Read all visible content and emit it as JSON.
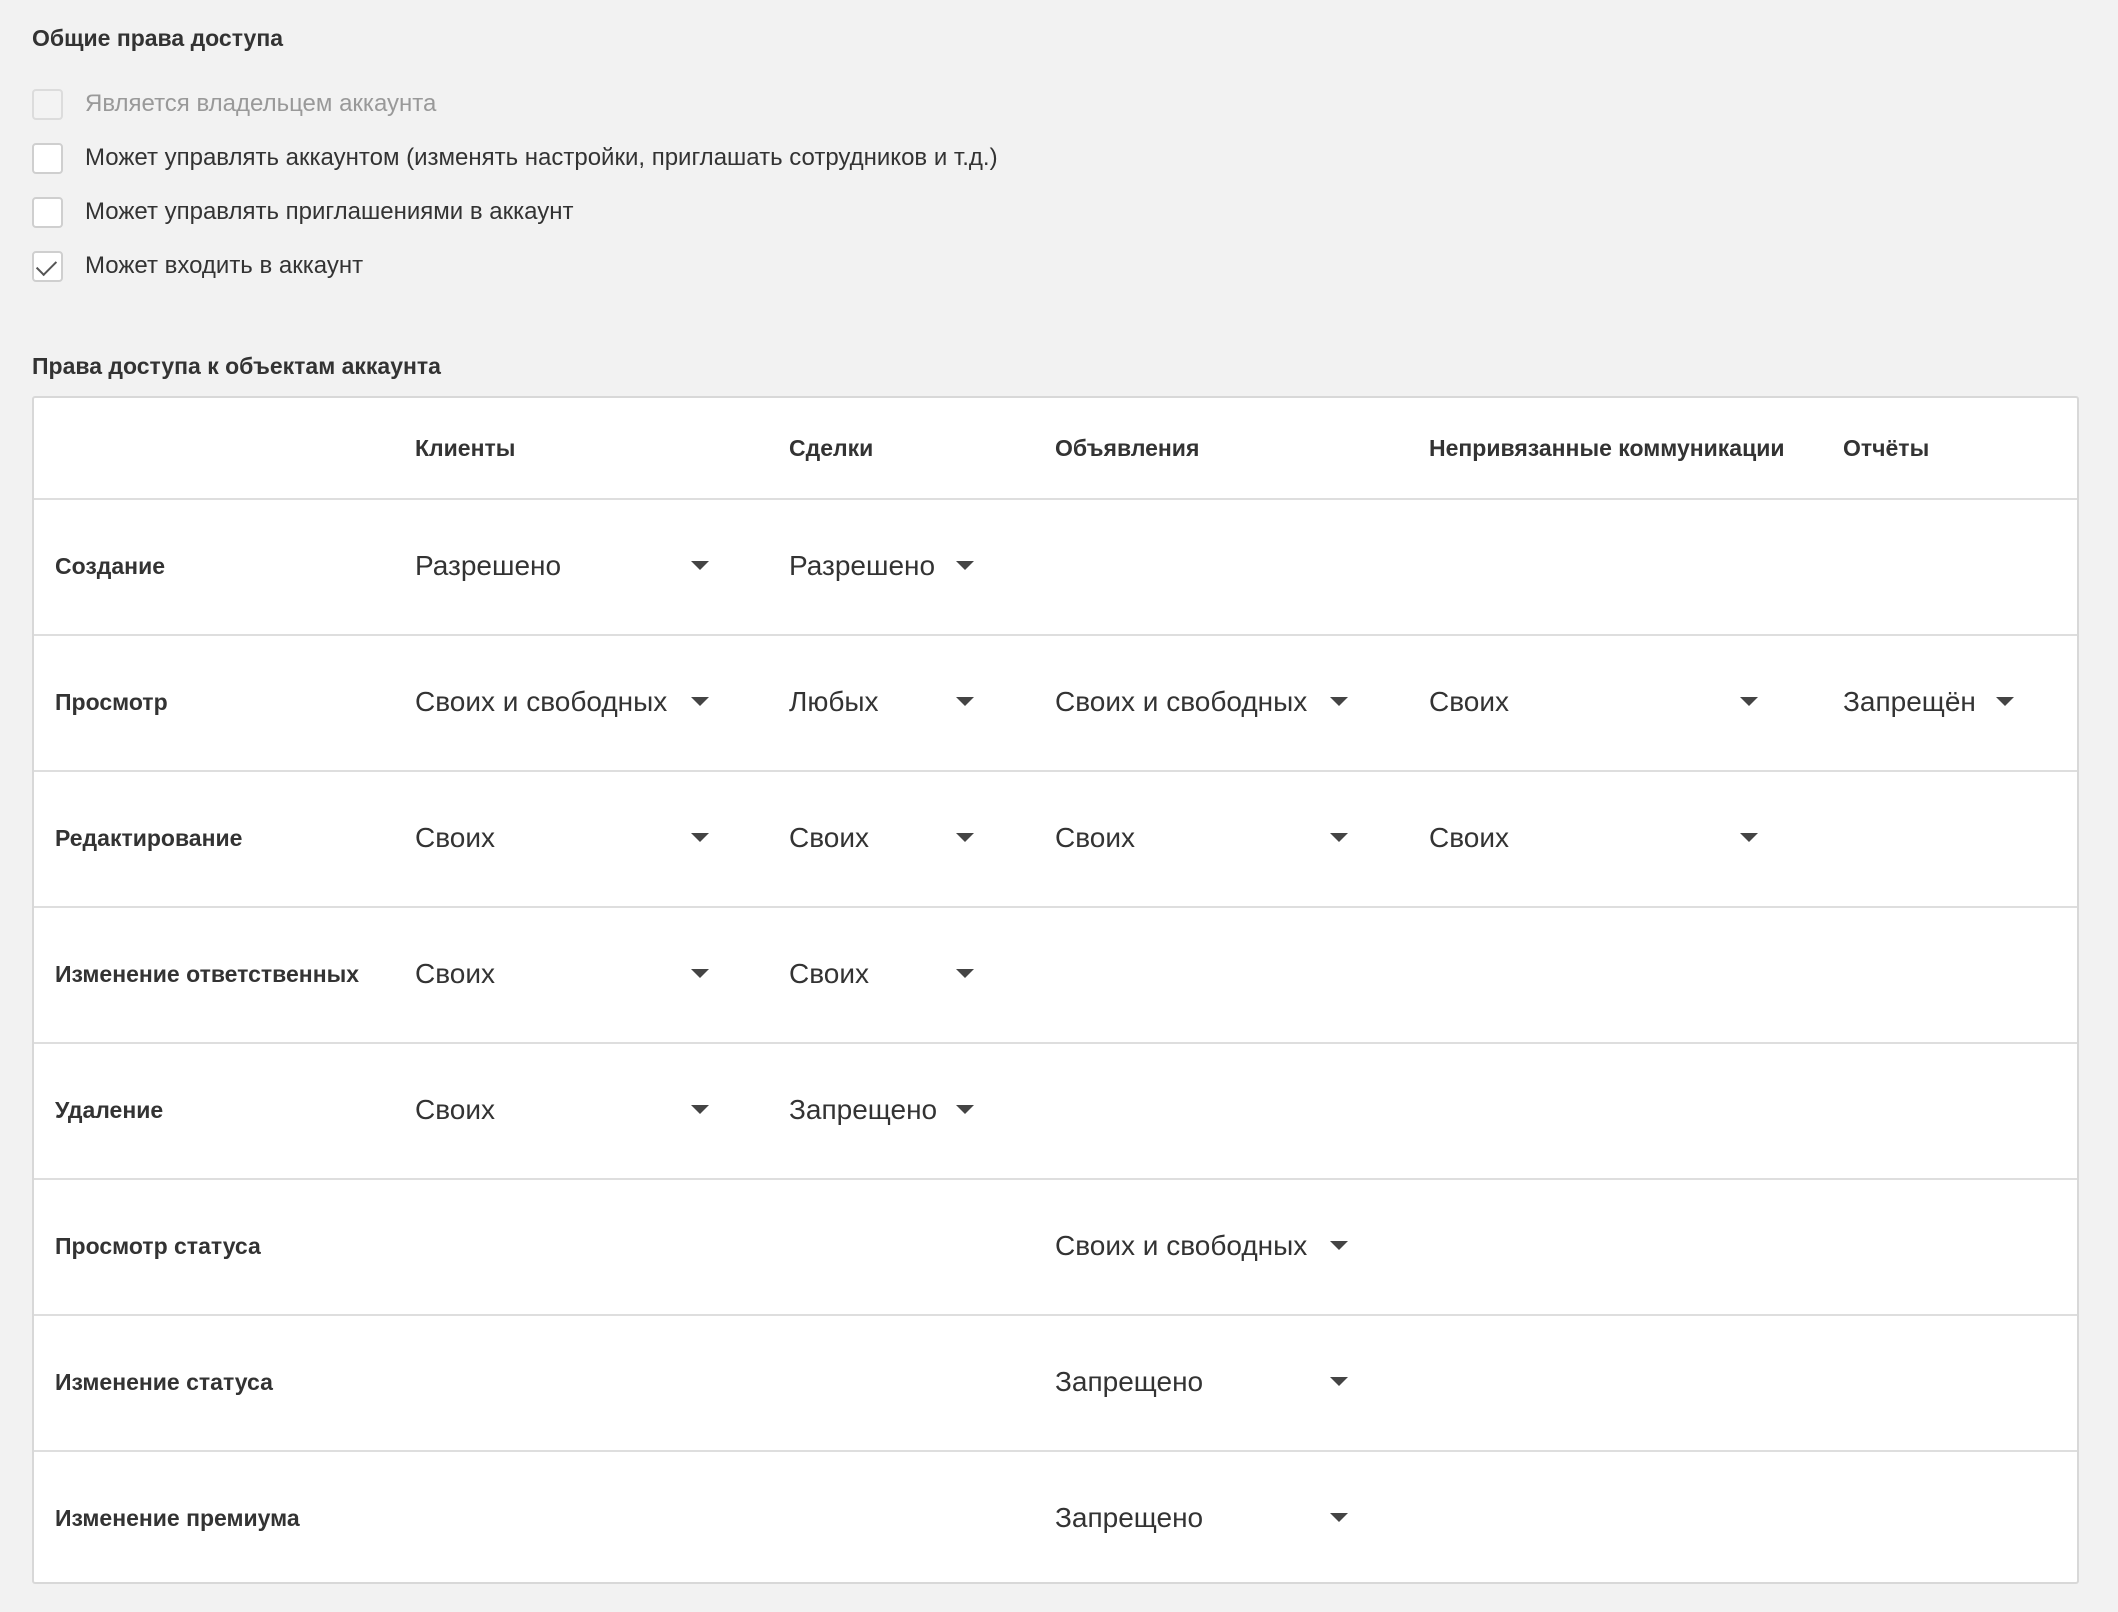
{
  "general": {
    "title": "Общие права доступа",
    "checkboxes": [
      {
        "label": "Является владельцем аккаунта",
        "checked": false,
        "disabled": true
      },
      {
        "label": "Может управлять аккаунтом (изменять настройки, приглашать сотрудников и т.д.)",
        "checked": false,
        "disabled": false
      },
      {
        "label": "Может управлять приглашениями в аккаунт",
        "checked": false,
        "disabled": false
      },
      {
        "label": "Может входить в аккаунт",
        "checked": true,
        "disabled": false
      }
    ]
  },
  "objects": {
    "title": "Права доступа к объектам аккаунта",
    "columns": [
      "Клиенты",
      "Сделки",
      "Объявления",
      "Непривязанные коммуникации",
      "Отчёты"
    ],
    "rows": [
      {
        "label": "Создание",
        "values": [
          "Разрешено",
          "Разрешено",
          null,
          null,
          null
        ]
      },
      {
        "label": "Просмотр",
        "values": [
          "Своих и свободных",
          "Любых",
          "Своих и свободных",
          "Своих",
          "Запрещён"
        ]
      },
      {
        "label": "Редактирование",
        "values": [
          "Своих",
          "Своих",
          "Своих",
          "Своих",
          null
        ]
      },
      {
        "label": "Изменение ответственных",
        "values": [
          "Своих",
          "Своих",
          null,
          null,
          null
        ]
      },
      {
        "label": "Удаление",
        "values": [
          "Своих",
          "Запрещено",
          null,
          null,
          null
        ]
      },
      {
        "label": "Просмотр статуса",
        "values": [
          null,
          null,
          "Своих и свободных",
          null,
          null
        ]
      },
      {
        "label": "Изменение статуса",
        "values": [
          null,
          null,
          "Запрещено",
          null,
          null
        ]
      },
      {
        "label": "Изменение премиума",
        "values": [
          null,
          null,
          "Запрещено",
          null,
          null
        ]
      }
    ]
  },
  "colors": {
    "background": "#f2f2f2",
    "card": "#ffffff",
    "border": "#d8d8d8",
    "text": "#333333",
    "muted": "#999999"
  },
  "icons": {
    "dropdown": "caret-down-icon",
    "check": "checkmark-icon"
  }
}
